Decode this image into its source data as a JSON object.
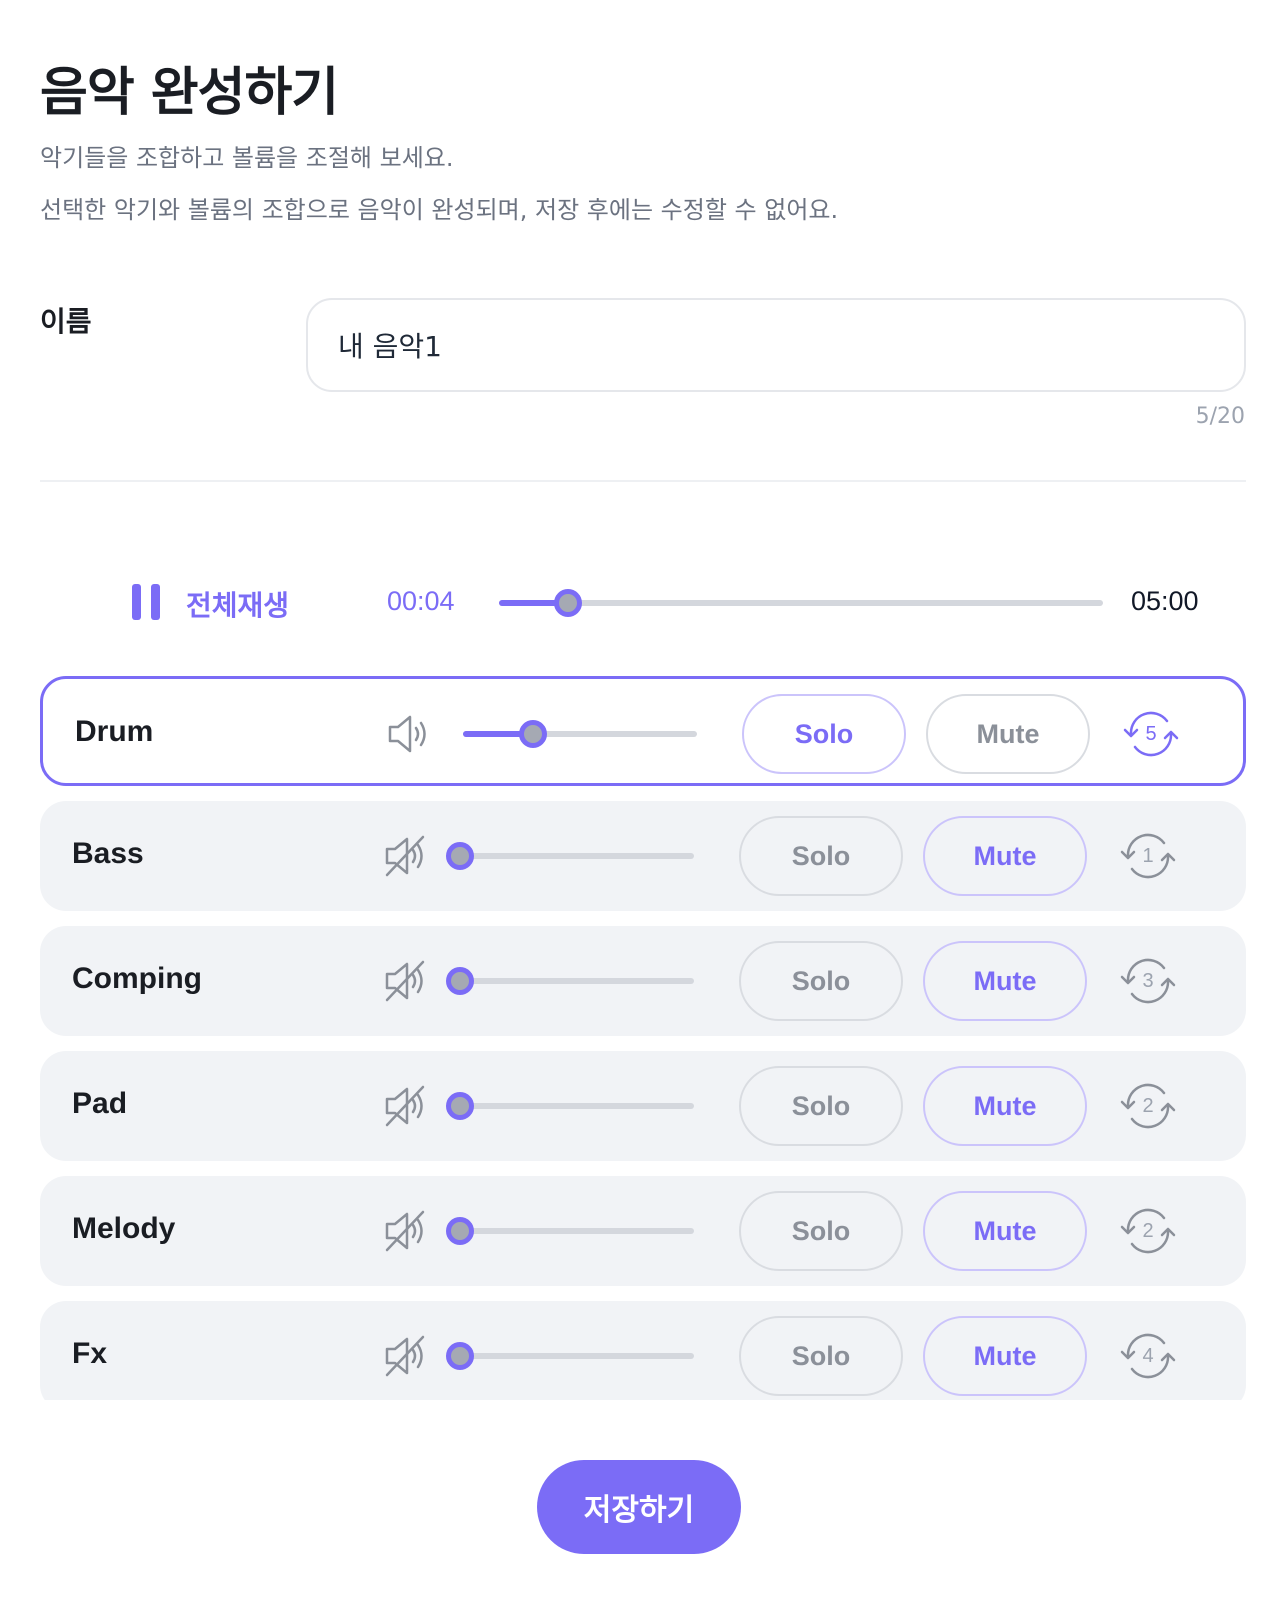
{
  "header": {
    "title": "음악 완성하기",
    "description_1": "악기들을 조합하고 볼륨을 조절해 보세요.",
    "description_2": "선택한 악기와 볼륨의 조합으로 음악이 완성되며, 저장 후에는 수정할 수 없어요."
  },
  "name_field": {
    "label": "이름",
    "value": "내 음악1",
    "counter": "5/20"
  },
  "player": {
    "play_all_label": "전체재생",
    "current_time": "00:04",
    "total_time": "05:00",
    "progress_percent": 11.5
  },
  "tracks": [
    {
      "name": "Drum",
      "muted": false,
      "volume_percent": 30,
      "solo_label": "Solo",
      "mute_label": "Mute",
      "solo_active": true,
      "mute_active": false,
      "variant": "5",
      "selected": true
    },
    {
      "name": "Bass",
      "muted": true,
      "volume_percent": 0,
      "solo_label": "Solo",
      "mute_label": "Mute",
      "solo_active": false,
      "mute_active": true,
      "variant": "1",
      "selected": false
    },
    {
      "name": "Comping",
      "muted": true,
      "volume_percent": 0,
      "solo_label": "Solo",
      "mute_label": "Mute",
      "solo_active": false,
      "mute_active": true,
      "variant": "3",
      "selected": false
    },
    {
      "name": "Pad",
      "muted": true,
      "volume_percent": 0,
      "solo_label": "Solo",
      "mute_label": "Mute",
      "solo_active": false,
      "mute_active": true,
      "variant": "2",
      "selected": false
    },
    {
      "name": "Melody",
      "muted": true,
      "volume_percent": 0,
      "solo_label": "Solo",
      "mute_label": "Mute",
      "solo_active": false,
      "mute_active": true,
      "variant": "2",
      "selected": false
    },
    {
      "name": "Fx",
      "muted": true,
      "volume_percent": 0,
      "solo_label": "Solo",
      "mute_label": "Mute",
      "solo_active": false,
      "mute_active": true,
      "variant": "4",
      "selected": false
    }
  ],
  "icons": {
    "pause": "pause-icon",
    "speaker": "speaker-icon",
    "speaker_muted": "speaker-muted-icon",
    "cycle": "cycle-variant-icon"
  },
  "colors": {
    "accent": "#7b6cf6",
    "track_bg": "#f1f3f6",
    "muted_text": "#8b9099"
  },
  "footer": {
    "save_label": "저장하기"
  }
}
